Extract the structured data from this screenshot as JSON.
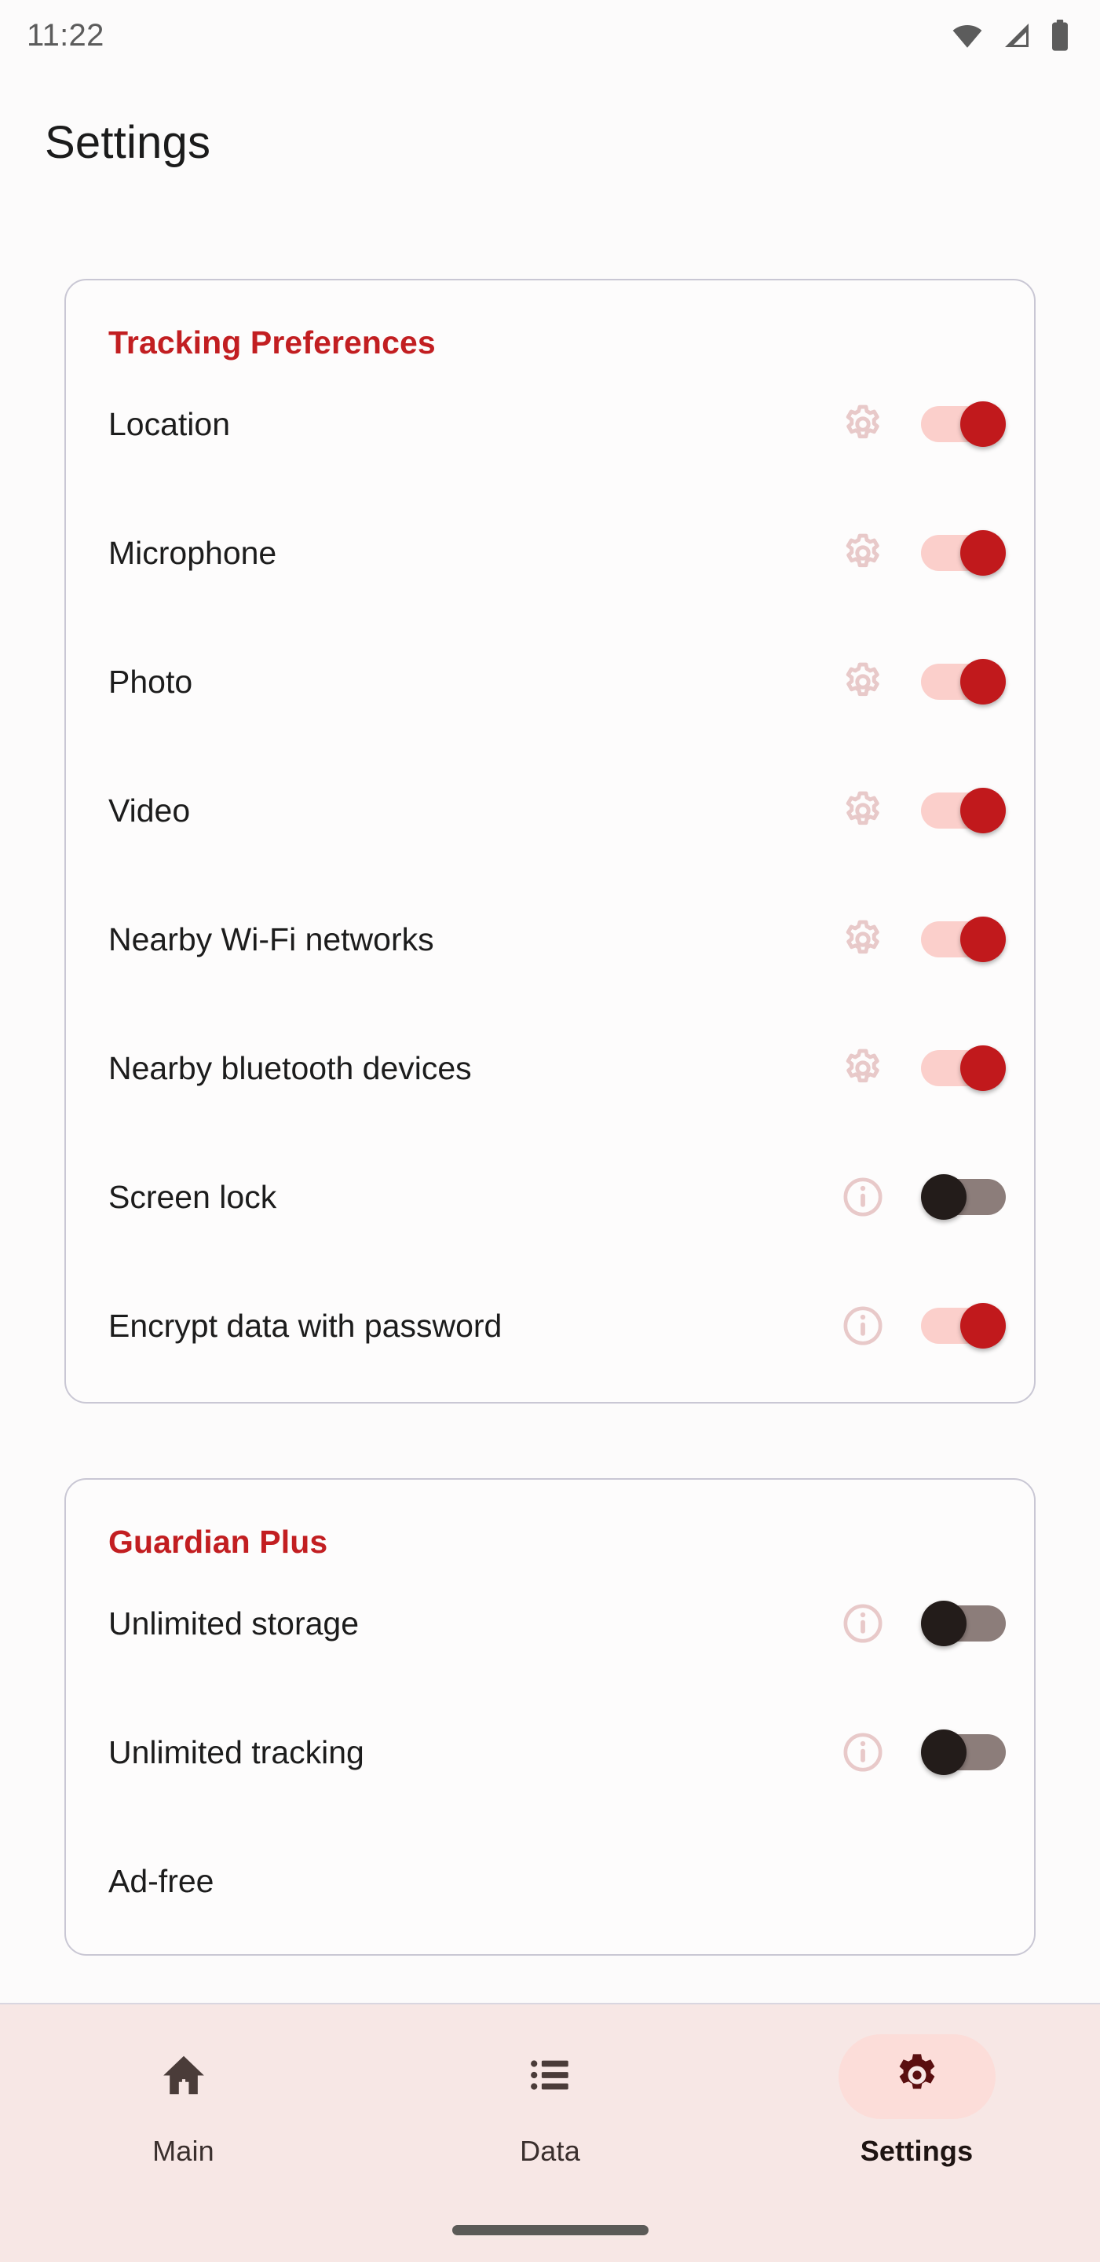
{
  "status_bar": {
    "time": "11:22",
    "icons": [
      "wifi-icon",
      "cellular-signal-icon",
      "battery-icon"
    ]
  },
  "header": {
    "title": "Settings"
  },
  "colors": {
    "accent_red": "#C21E21",
    "toggle_on_track": "#FBCFCB",
    "toggle_on_thumb": "#C1191C",
    "toggle_off_track": "#8C7D7A",
    "toggle_off_thumb": "#231C1A",
    "muted_pink_icon": "#E8C9C9",
    "card_border": "#C9C7D4",
    "navbar_bg": "#F7E7E5",
    "nav_pill_active": "#FCDDD9",
    "page_bg": "#FCFBFB"
  },
  "cards": [
    {
      "title": "Tracking Preferences",
      "rows": [
        {
          "label": "Location",
          "icon": "gear-icon",
          "toggle": "on"
        },
        {
          "label": "Microphone",
          "icon": "gear-icon",
          "toggle": "on"
        },
        {
          "label": "Photo",
          "icon": "gear-icon",
          "toggle": "on"
        },
        {
          "label": "Video",
          "icon": "gear-icon",
          "toggle": "on"
        },
        {
          "label": "Nearby Wi-Fi networks",
          "icon": "gear-icon",
          "toggle": "on"
        },
        {
          "label": "Nearby bluetooth devices",
          "icon": "gear-icon",
          "toggle": "on"
        },
        {
          "label": "Screen lock",
          "icon": "info-icon",
          "toggle": "off"
        },
        {
          "label": "Encrypt data with password",
          "icon": "info-icon",
          "toggle": "on"
        }
      ]
    },
    {
      "title": "Guardian Plus",
      "rows": [
        {
          "label": "Unlimited storage",
          "icon": "info-icon",
          "toggle": "off"
        },
        {
          "label": "Unlimited tracking",
          "icon": "info-icon",
          "toggle": "off"
        },
        {
          "label": "Ad-free",
          "icon": "none",
          "toggle": "none"
        }
      ]
    }
  ],
  "bottom_nav": {
    "items": [
      {
        "label": "Main",
        "icon": "home-icon",
        "active": false
      },
      {
        "label": "Data",
        "icon": "list-icon",
        "active": false
      },
      {
        "label": "Settings",
        "icon": "gear-icon",
        "active": true
      }
    ]
  }
}
